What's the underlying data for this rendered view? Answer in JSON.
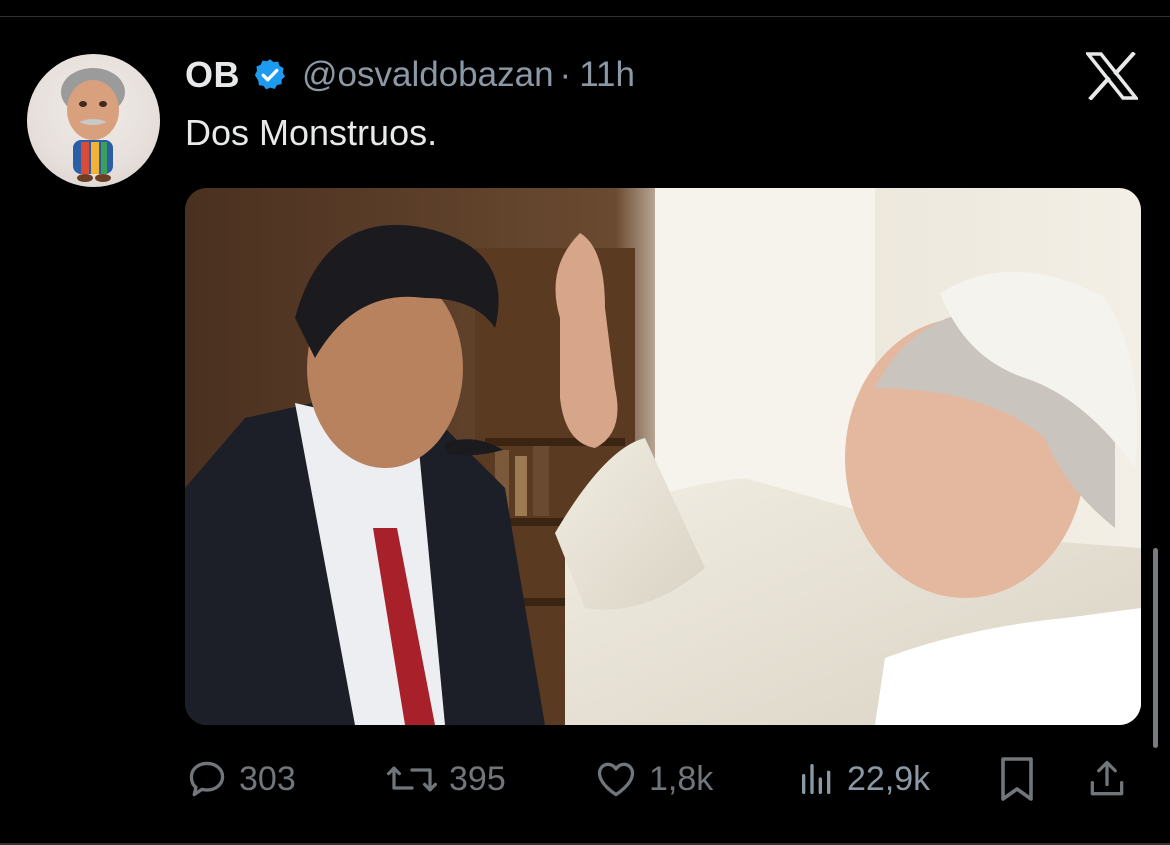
{
  "tweet": {
    "author": {
      "display_name": "OB",
      "handle": "@osvaldobazan",
      "verified": true,
      "avatar_icon": "caricature-avatar"
    },
    "separator": "·",
    "timestamp": "11h",
    "text": "Dos Monstruos.",
    "media": {
      "type": "photo",
      "icon": "photo-two-men-blessing"
    }
  },
  "actions": {
    "reply": {
      "icon": "reply-icon",
      "count": "303"
    },
    "repost": {
      "icon": "repost-icon",
      "count": "395"
    },
    "like": {
      "icon": "heart-icon",
      "count": "1,8k"
    },
    "views": {
      "icon": "views-chart-icon",
      "count": "22,9k"
    },
    "bookmark": {
      "icon": "bookmark-icon"
    },
    "share": {
      "icon": "share-icon"
    }
  },
  "brand": {
    "icon": "x-logo",
    "accent": "#1d9bf0",
    "action_gray": "#71767b",
    "views_color": "#8b98a5"
  }
}
